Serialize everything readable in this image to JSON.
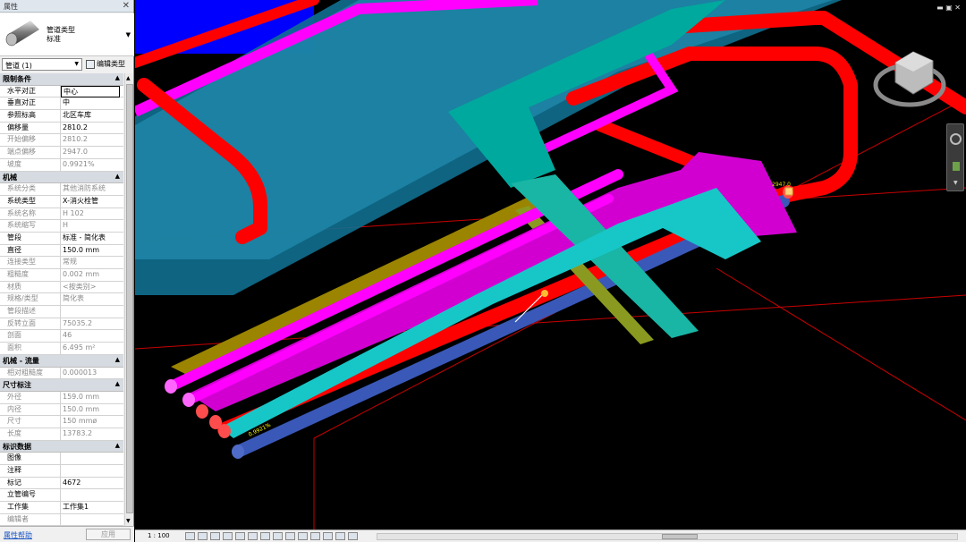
{
  "properties_panel": {
    "title": "属性",
    "close_glyph": "✕",
    "type_family": "管道类型",
    "type_name": "标准",
    "selector_value": "管道 (1)",
    "edit_type_label": "编辑类型",
    "help_link": "属性帮助",
    "apply_label": "应用",
    "sections": [
      {
        "name": "限制条件",
        "rows": [
          {
            "k": "水平对正",
            "v": "中心",
            "ro": false,
            "hl": true
          },
          {
            "k": "垂直对正",
            "v": "中",
            "ro": false
          },
          {
            "k": "参照标高",
            "v": "北区车库",
            "ro": false
          },
          {
            "k": "偏移量",
            "v": "2810.2",
            "ro": false
          },
          {
            "k": "开始偏移",
            "v": "2810.2",
            "ro": true
          },
          {
            "k": "端点偏移",
            "v": "2947.0",
            "ro": true
          },
          {
            "k": "坡度",
            "v": "0.9921%",
            "ro": true
          }
        ]
      },
      {
        "name": "机械",
        "rows": [
          {
            "k": "系统分类",
            "v": "其他消防系统",
            "ro": true
          },
          {
            "k": "系统类型",
            "v": "X-消火栓管",
            "ro": false
          },
          {
            "k": "系统名称",
            "v": "H 102",
            "ro": true
          },
          {
            "k": "系统缩写",
            "v": "H",
            "ro": true
          },
          {
            "k": "管段",
            "v": "标准 - 简化表",
            "ro": false
          },
          {
            "k": "直径",
            "v": "150.0 mm",
            "ro": false
          },
          {
            "k": "连接类型",
            "v": "常规",
            "ro": true
          },
          {
            "k": "粗糙度",
            "v": "0.002 mm",
            "ro": true
          },
          {
            "k": "材质",
            "v": "<按类别>",
            "ro": true
          },
          {
            "k": "规格/类型",
            "v": "简化表",
            "ro": true
          },
          {
            "k": "管段描述",
            "v": "",
            "ro": true
          },
          {
            "k": "反转立面",
            "v": "75035.2",
            "ro": true
          },
          {
            "k": "剖面",
            "v": "46",
            "ro": true
          },
          {
            "k": "面积",
            "v": "6.495 m²",
            "ro": true
          }
        ]
      },
      {
        "name": "机械 - 流量",
        "rows": [
          {
            "k": "相对粗糙度",
            "v": "0.000013",
            "ro": true
          }
        ]
      },
      {
        "name": "尺寸标注",
        "rows": [
          {
            "k": "外径",
            "v": "159.0 mm",
            "ro": true
          },
          {
            "k": "内径",
            "v": "150.0 mm",
            "ro": true
          },
          {
            "k": "尺寸",
            "v": "150 mmø",
            "ro": true
          },
          {
            "k": "长度",
            "v": "13783.2",
            "ro": true
          }
        ]
      },
      {
        "name": "标识数据",
        "rows": [
          {
            "k": "图像",
            "v": "",
            "ro": false
          },
          {
            "k": "注释",
            "v": "",
            "ro": false
          },
          {
            "k": "标记",
            "v": "4672",
            "ro": false
          },
          {
            "k": "立管编号",
            "v": "",
            "ro": false
          },
          {
            "k": "工作集",
            "v": "工作集1",
            "ro": false
          },
          {
            "k": "编辑者",
            "v": "",
            "ro": true
          }
        ]
      }
    ]
  },
  "viewport": {
    "label_top": "2947.0",
    "label_bottom": "0.9921%"
  },
  "status_bar": {
    "scale": "1 : 100"
  },
  "colors": {
    "red": "#ff0000",
    "magenta": "#ff00ff",
    "teal": "#00a99d",
    "olive": "#9b8400",
    "blue": "#2b4aa8"
  }
}
